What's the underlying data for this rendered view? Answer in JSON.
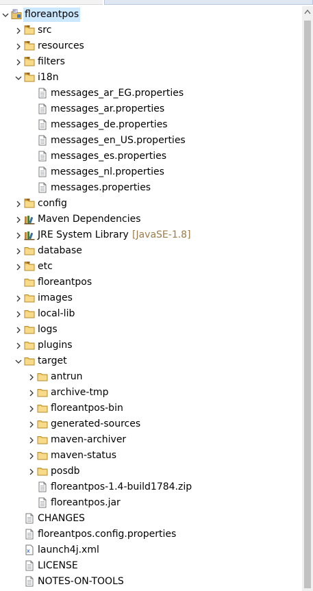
{
  "project": {
    "name": "floreantpos"
  },
  "items": [
    {
      "label": "src",
      "kind": "pkgfolder",
      "twisty": "collapsed"
    },
    {
      "label": "resources",
      "kind": "pkgfolder",
      "twisty": "collapsed"
    },
    {
      "label": "filters",
      "kind": "pkgfolder",
      "twisty": "collapsed"
    },
    {
      "label": "i18n",
      "kind": "pkgfolder",
      "twisty": "expanded"
    },
    {
      "label": "messages_ar_EG.properties",
      "kind": "file"
    },
    {
      "label": "messages_ar.properties",
      "kind": "file"
    },
    {
      "label": "messages_de.properties",
      "kind": "file"
    },
    {
      "label": "messages_en_US.properties",
      "kind": "file"
    },
    {
      "label": "messages_es.properties",
      "kind": "file"
    },
    {
      "label": "messages_nl.properties",
      "kind": "file"
    },
    {
      "label": "messages.properties",
      "kind": "file"
    },
    {
      "label": "config",
      "kind": "pkgfolder",
      "twisty": "collapsed"
    },
    {
      "label": "Maven Dependencies",
      "kind": "library",
      "twisty": "collapsed"
    },
    {
      "label": "JRE System Library",
      "decoration": "[JavaSE-1.8]",
      "kind": "library",
      "twisty": "collapsed"
    },
    {
      "label": "database",
      "kind": "folder",
      "twisty": "collapsed"
    },
    {
      "label": "etc",
      "kind": "pkgfolder",
      "twisty": "collapsed"
    },
    {
      "label": "floreantpos",
      "kind": "folder"
    },
    {
      "label": "images",
      "kind": "folder",
      "twisty": "collapsed"
    },
    {
      "label": "local-lib",
      "kind": "folder",
      "twisty": "collapsed"
    },
    {
      "label": "logs",
      "kind": "folder",
      "twisty": "collapsed"
    },
    {
      "label": "plugins",
      "kind": "folder",
      "twisty": "collapsed"
    },
    {
      "label": "target",
      "kind": "folder",
      "twisty": "expanded"
    },
    {
      "label": "antrun",
      "kind": "folder",
      "twisty": "collapsed"
    },
    {
      "label": "archive-tmp",
      "kind": "folder",
      "twisty": "collapsed"
    },
    {
      "label": "floreantpos-bin",
      "kind": "folder",
      "twisty": "collapsed"
    },
    {
      "label": "generated-sources",
      "kind": "folder",
      "twisty": "collapsed"
    },
    {
      "label": "maven-archiver",
      "kind": "folder",
      "twisty": "collapsed"
    },
    {
      "label": "maven-status",
      "kind": "folder",
      "twisty": "collapsed"
    },
    {
      "label": "posdb",
      "kind": "folder",
      "twisty": "collapsed"
    },
    {
      "label": "floreantpos-1.4-build1784.zip",
      "kind": "file"
    },
    {
      "label": "floreantpos.jar",
      "kind": "file"
    },
    {
      "label": "CHANGES",
      "kind": "file"
    },
    {
      "label": "floreantpos.config.properties",
      "kind": "file"
    },
    {
      "label": "launch4j.xml",
      "kind": "xml"
    },
    {
      "label": "LICENSE",
      "kind": "file"
    },
    {
      "label": "NOTES-ON-TOOLS",
      "kind": "file"
    }
  ]
}
